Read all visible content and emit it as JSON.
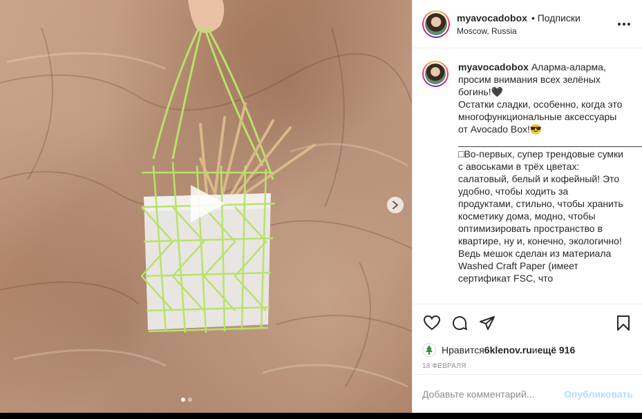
{
  "post": {
    "username": "myavocadobox",
    "follow_label": "• Подписки",
    "location": "Moscow, Russia"
  },
  "caption": {
    "username": "myavocadobox",
    "text": "Аларма-аларма, просим внимания всех зелёных богинь!🖤\nОстатки сладки, особенно, когда это многофункциональные аксессуары от Avocado Box!😎\n_______________________________________________\n□Во-первых, супер трендовые сумки с авоськами в трёх цветах: салатовый, белый и кофейный! Это удобно, чтобы ходить за продуктами, стильно, чтобы хранить косметику дома, модно, чтобы оптимизировать пространство в квартире, ну и, конечно, экологично! Ведь мешок сделан из материала Washed Craft Paper (имеет сертификат FSC, что"
  },
  "likes": {
    "prefix": "Нравится ",
    "liker": "6klenov.ru",
    "middle": " и ",
    "others": "ещё 916"
  },
  "date": "18 февраля",
  "comment_input": {
    "placeholder": "Добавьте комментарий...",
    "value": ""
  },
  "publish_label": "Опубликовать",
  "carousel": {
    "slides": 2,
    "active_index": 0
  },
  "icons": [
    "more-icon",
    "heart-icon",
    "comment-icon",
    "share-icon",
    "bookmark-icon",
    "play-icon",
    "chevron-right-icon"
  ],
  "colors": {
    "publish_disabled": "#b3dbff",
    "muted_text": "#8e8e8e",
    "text": "#262626"
  }
}
